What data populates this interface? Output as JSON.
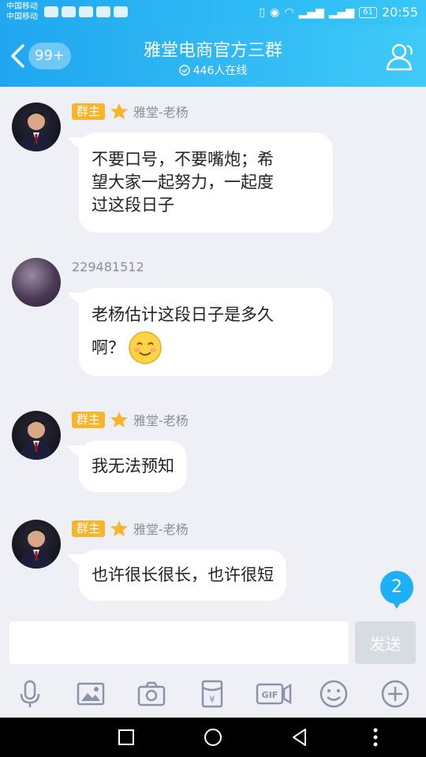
{
  "status_bar": {
    "carrier_1": "中国移动",
    "carrier_2": "中国移动",
    "battery": "61",
    "time": "20:55"
  },
  "header": {
    "unread_badge": "99+",
    "title": "雅堂电商官方三群",
    "online": "446人在线"
  },
  "messages": [
    {
      "role": "群主",
      "sender": "雅堂-老杨",
      "lines": [
        "不要口号，不要嘴炮；希",
        "望大家一起努力，一起度",
        "过这段日子"
      ]
    },
    {
      "role": "",
      "sender": "229481512",
      "lines": [
        "老杨估计这段日子是多久",
        "啊？"
      ]
    },
    {
      "role": "群主",
      "sender": "雅堂-老杨",
      "lines": [
        "我无法预知"
      ]
    },
    {
      "role": "群主",
      "sender": "雅堂-老杨",
      "lines": [
        "也许很长很长，也许很短"
      ]
    }
  ],
  "unread_count": "2",
  "composer": {
    "placeholder": "",
    "send_label": "发送"
  },
  "colors": {
    "header": "#1fa6f0",
    "role_badge": "#f7b52b",
    "unread": "#1eb0f5"
  }
}
